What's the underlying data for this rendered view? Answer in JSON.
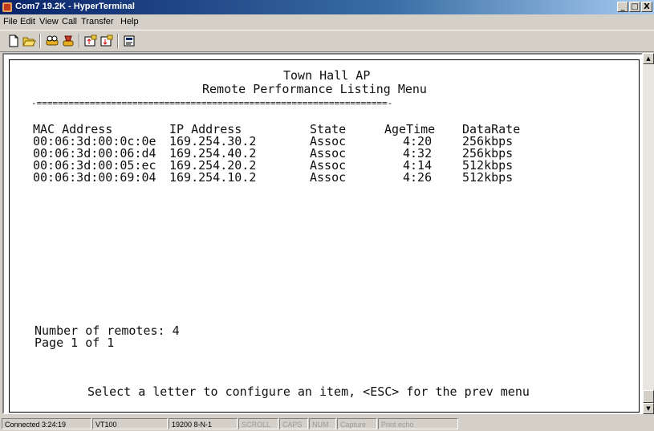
{
  "window": {
    "title": "Com7 19.2K - HyperTerminal",
    "controls": [
      "_",
      "□",
      "X"
    ]
  },
  "menu": [
    "File",
    "Edit",
    "View",
    "Call",
    "Transfer",
    "Help"
  ],
  "toolbar": [
    "new-icon",
    "open-icon",
    "disconnect-icon",
    "dial-icon",
    "send-icon",
    "receive-icon",
    "properties-icon"
  ],
  "terminal": {
    "title": "Town Hall AP",
    "subtitle": "Remote Performance Listing Menu",
    "rule": "-==================================================================-",
    "columns": [
      "MAC Address",
      "IP Address",
      "State",
      "AgeTime",
      "DataRate"
    ],
    "rows": [
      {
        "mac": "00:06:3d:00:0c:0e",
        "ip": "169.254.30.2",
        "state": "Assoc",
        "age": "4:20",
        "rate": "256kbps"
      },
      {
        "mac": "00:06:3d:00:06:d4",
        "ip": "169.254.40.2",
        "state": "Assoc",
        "age": "4:32",
        "rate": "256kbps"
      },
      {
        "mac": "00:06:3d:00:05:ec",
        "ip": "169.254.20.2",
        "state": "Assoc",
        "age": "4:14",
        "rate": "512kbps"
      },
      {
        "mac": "00:06:3d:00:69:04",
        "ip": "169.254.10.2",
        "state": "Assoc",
        "age": "4:26",
        "rate": "512kbps"
      }
    ],
    "remotes": "Number of remotes: 4",
    "page": "Page 1 of 1",
    "prompt": "Select a letter to configure an item, <ESC> for the prev menu"
  },
  "status": {
    "connected": "Connected 3:24:19",
    "emulation": "VT100",
    "settings": "19200 8-N-1",
    "scroll": "SCROLL",
    "caps": "CAPS",
    "num": "NUM",
    "capture": "Capture",
    "echo": "Print echo"
  }
}
